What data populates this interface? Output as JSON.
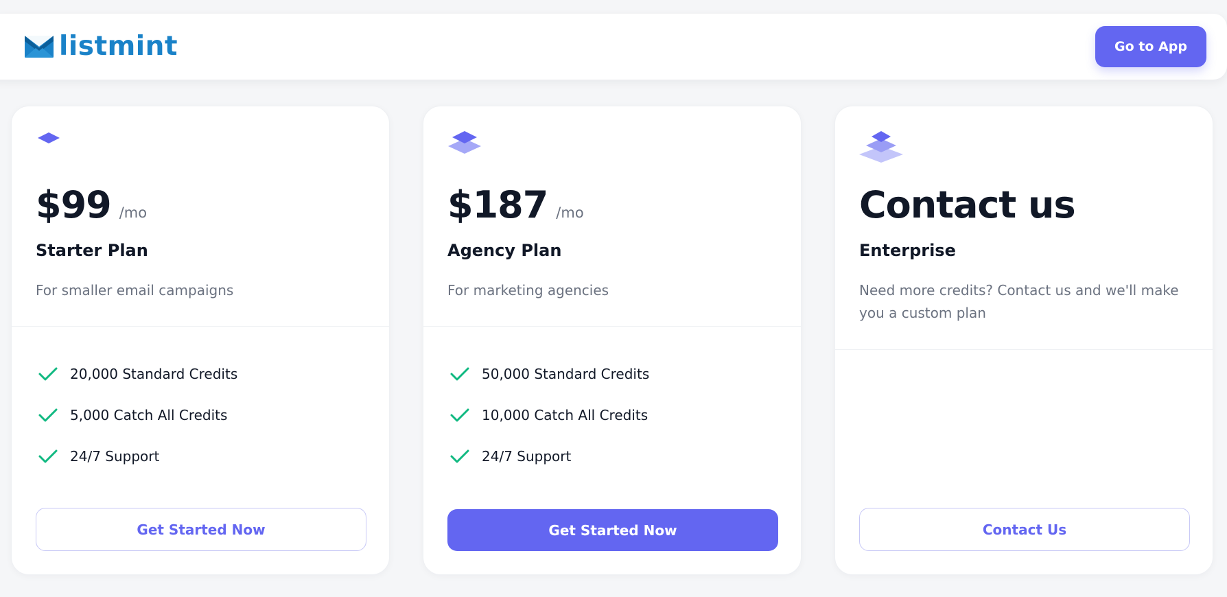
{
  "brand": {
    "name": "listmint",
    "color": "#1a82c8"
  },
  "header": {
    "go_to_app_label": "Go to App"
  },
  "accent_color": "#6366f1",
  "check_color": "#10b981",
  "plans": [
    {
      "icon": "single-layer-icon",
      "price": "$99",
      "period": "/mo",
      "name": "Starter Plan",
      "description": "For smaller email campaigns",
      "features": [
        "20,000 Standard Credits",
        "5,000 Catch All Credits",
        "24/7 Support"
      ],
      "cta": "Get Started Now"
    },
    {
      "icon": "double-layer-icon",
      "price": "$187",
      "period": "/mo",
      "name": "Agency Plan",
      "description": "For marketing agencies",
      "features": [
        "50,000 Standard Credits",
        "10,000 Catch All Credits",
        "24/7 Support"
      ],
      "cta": "Get Started Now"
    },
    {
      "icon": "triple-layer-icon",
      "price": "Contact us",
      "name": "Enterprise",
      "description": "Need more credits? Contact us and we'll make you a custom plan",
      "features": [],
      "cta": "Contact Us"
    }
  ]
}
